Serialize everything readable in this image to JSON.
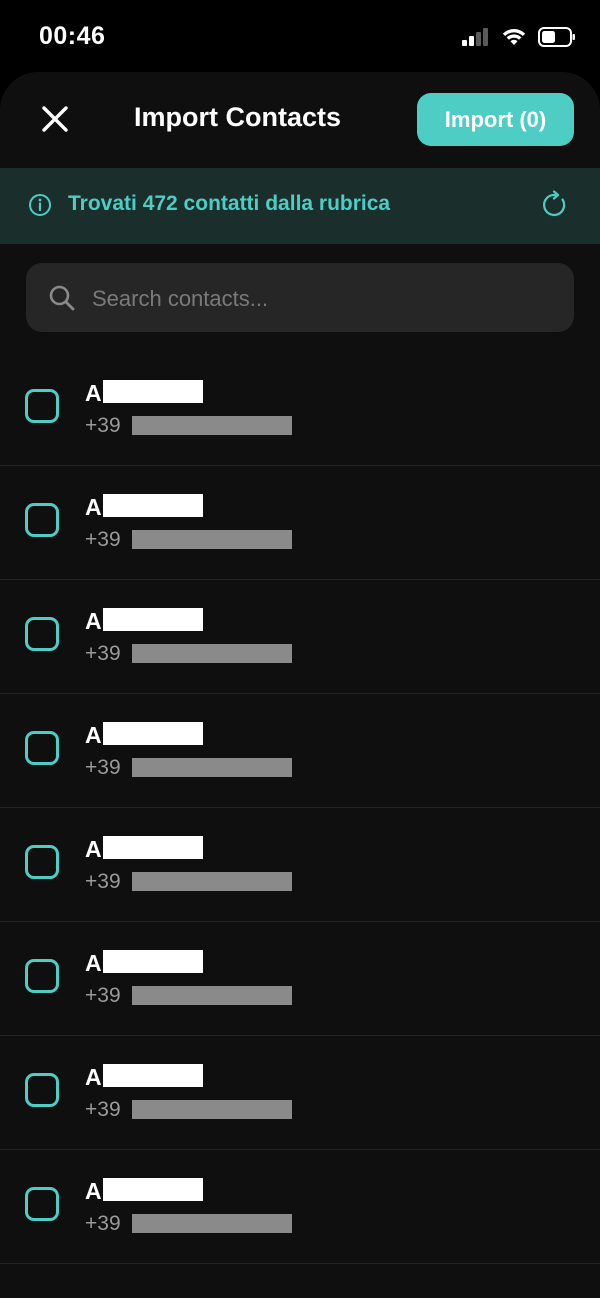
{
  "status_bar": {
    "time": "00:46",
    "icons": [
      "signal-icon",
      "wifi-icon",
      "battery-icon"
    ]
  },
  "header": {
    "close_icon": "close-icon",
    "title": "Import Contacts",
    "import_button": "Import (0)"
  },
  "info_banner": {
    "icon": "info-icon",
    "text": "Trovati 472 contatti dalla rubrica",
    "refresh_icon": "refresh-icon"
  },
  "search": {
    "icon": "search-icon",
    "placeholder": "Search contacts...",
    "value": ""
  },
  "contacts": [
    {
      "initial": "A",
      "phone_prefix": "+39",
      "checked": false
    },
    {
      "initial": "A",
      "phone_prefix": "+39",
      "checked": false
    },
    {
      "initial": "A",
      "phone_prefix": "+39",
      "checked": false
    },
    {
      "initial": "A",
      "phone_prefix": "+39",
      "checked": false
    },
    {
      "initial": "A",
      "phone_prefix": "+39",
      "checked": false
    },
    {
      "initial": "A",
      "phone_prefix": "+39",
      "checked": false
    },
    {
      "initial": "A",
      "phone_prefix": "+39",
      "checked": false
    },
    {
      "initial": "A",
      "phone_prefix": "+39",
      "checked": false
    }
  ],
  "colors": {
    "accent": "#4ecdc4",
    "background": "#000000",
    "sheet": "#0f0f0f",
    "banner": "#1a2e2c",
    "search_field": "#262626",
    "text_secondary": "#9a9a9a"
  }
}
